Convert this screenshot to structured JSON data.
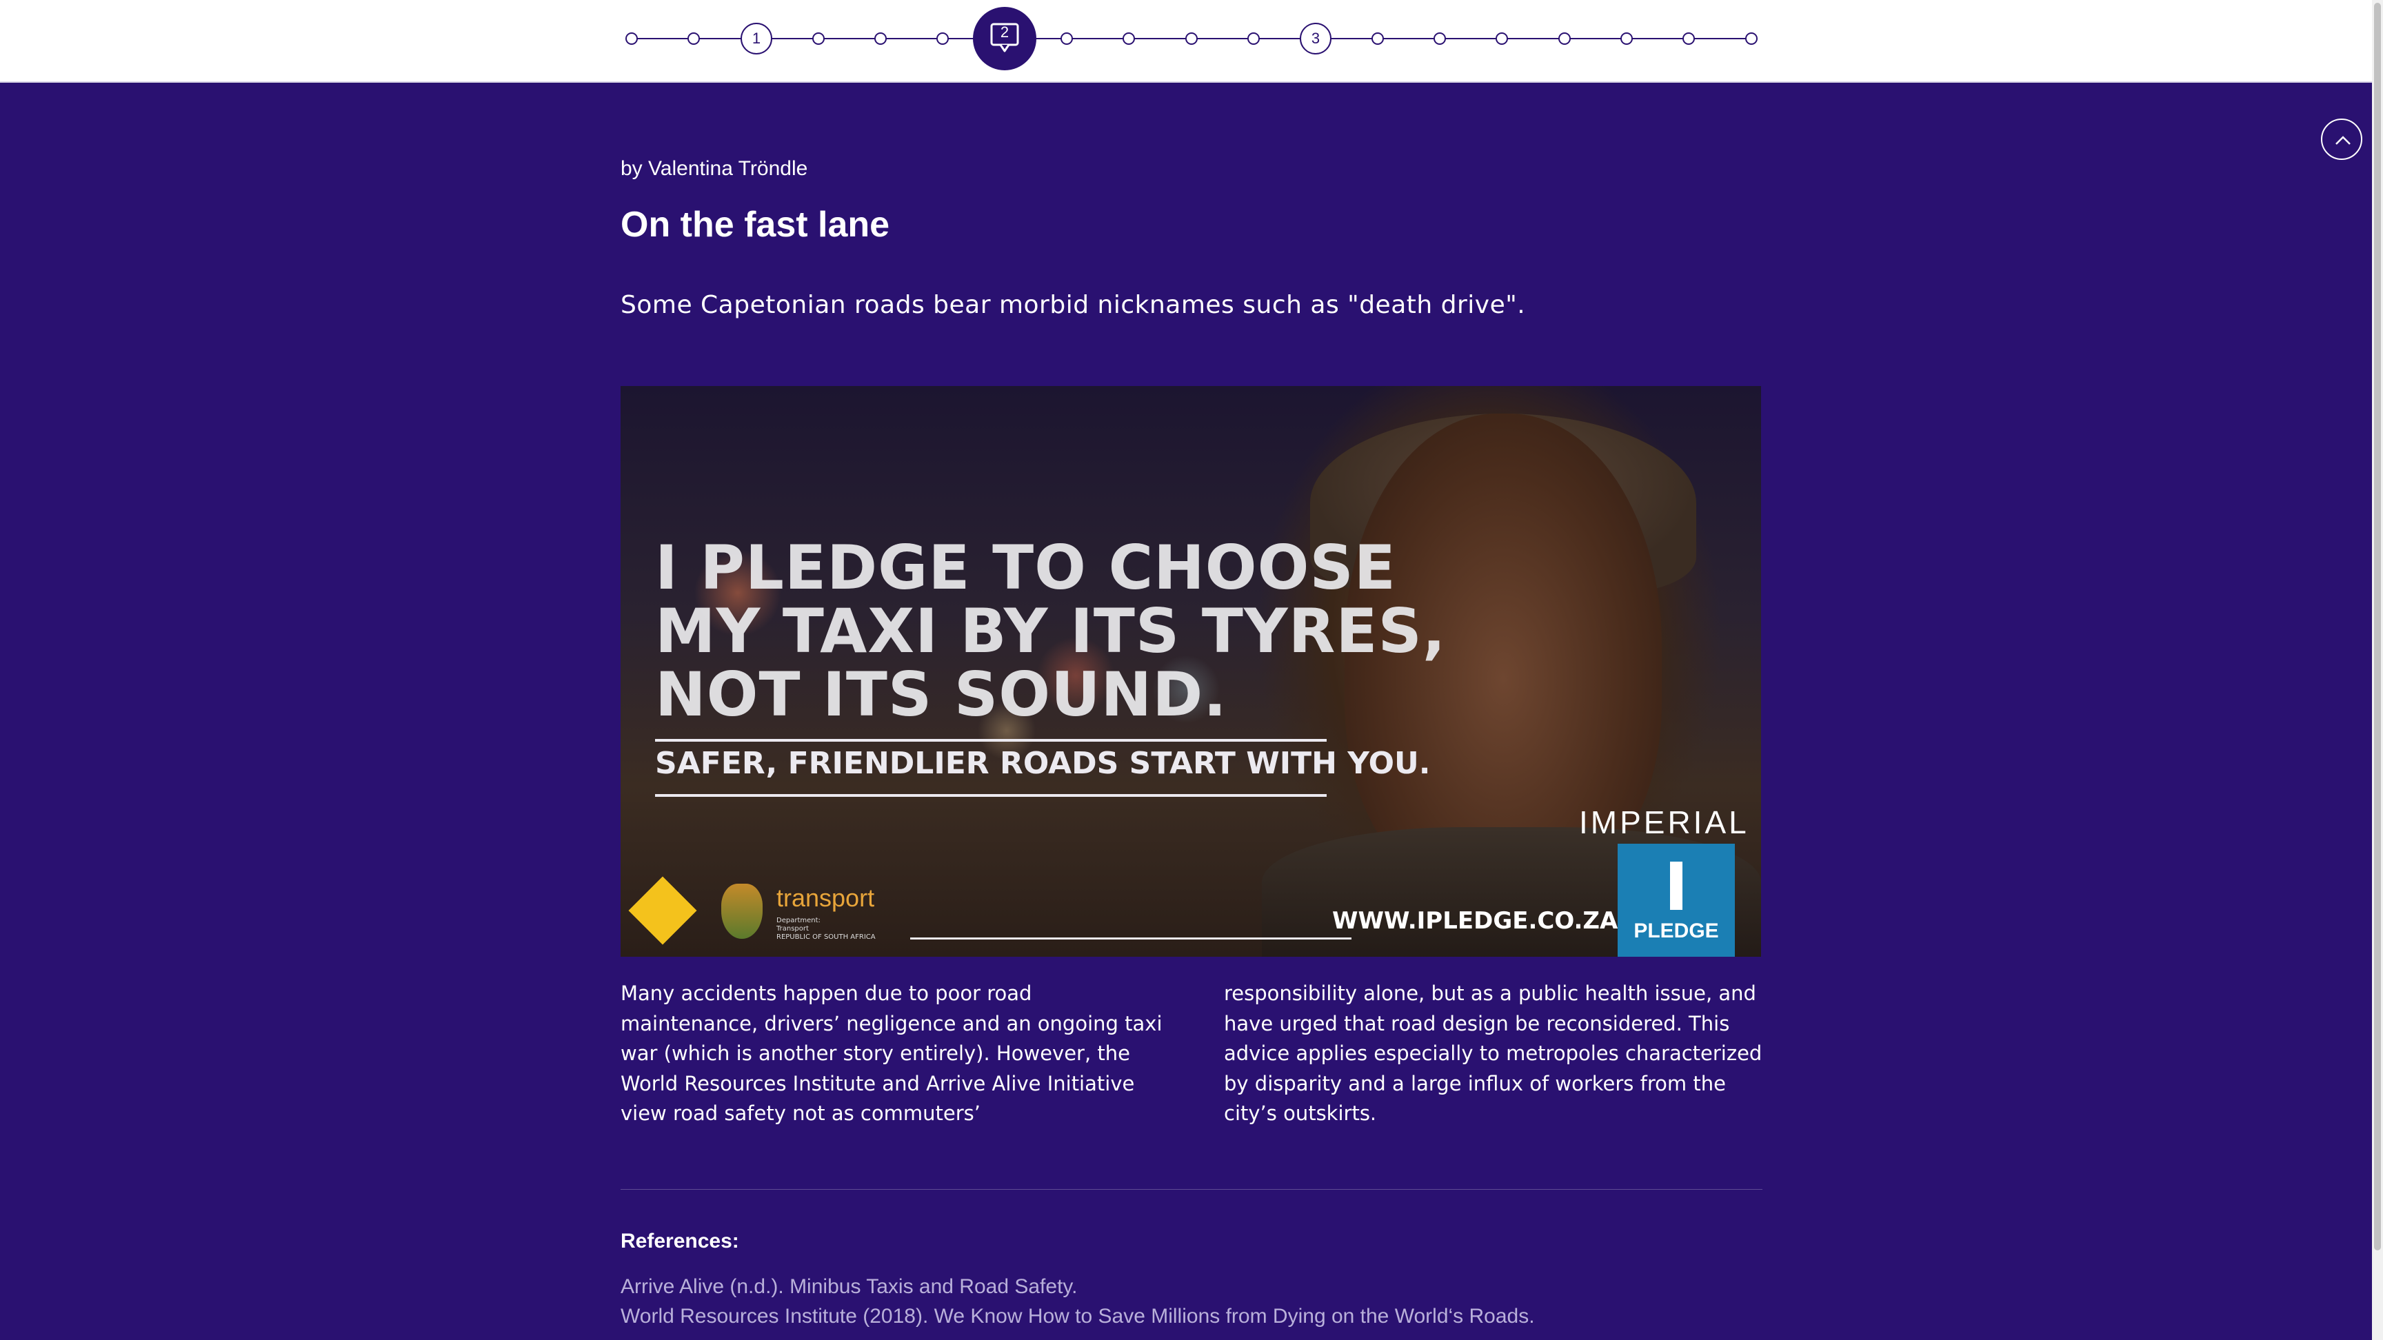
{
  "nav": {
    "chapters": [
      "1",
      "2",
      "3"
    ],
    "active_chapter": "2"
  },
  "article": {
    "byline": "by Valentina Tröndle",
    "title": "On the fast lane",
    "lead": "Some Capetonian roads bear morbid nicknames such as \"death drive\".",
    "image": {
      "headline_lines": [
        "I PLEDGE TO CHOOSE",
        "MY TAXI BY ITS TYRES,",
        "NOT ITS SOUND."
      ],
      "tagline": "SAFER, FRIENDLIER ROADS START WITH YOU.",
      "transport_label": "transport",
      "department_text": "Department:\nTransport\nREPUBLIC OF SOUTH AFRICA",
      "url": "WWW.IPLEDGE.CO.ZA",
      "brand": "IMPERIAL",
      "pledge_label": "PLEDGE"
    },
    "body_left": "Many accidents happen due to poor road maintenance, drivers’ negligence and an ongoing taxi war (which is another story entirely). However, the World Resources Institute and Arrive Alive Initiative view road safety not as commuters’",
    "body_right": "responsibility alone, but as a public health issue, and have urged that road design be reconsidered. This advice applies especially to metropoles characterized by disparity and a large influx of workers from the city’s outskirts."
  },
  "references": {
    "heading": "References:",
    "items": [
      "Arrive Alive (n.d.). Minibus Taxis and Road Safety.",
      "World Resources Institute (2018). We Know How to Save Millions from Dying on the World‘s Roads."
    ]
  },
  "colors": {
    "background": "#2a1171",
    "nav_background": "#ffffff",
    "reference_text": "#b9b0da",
    "pledge_blue": "#1b7fb4",
    "transport_orange": "#e8a53a"
  },
  "icons": {
    "active_chapter": "speech-bubble-icon",
    "scroll_top": "chevron-up-icon"
  }
}
